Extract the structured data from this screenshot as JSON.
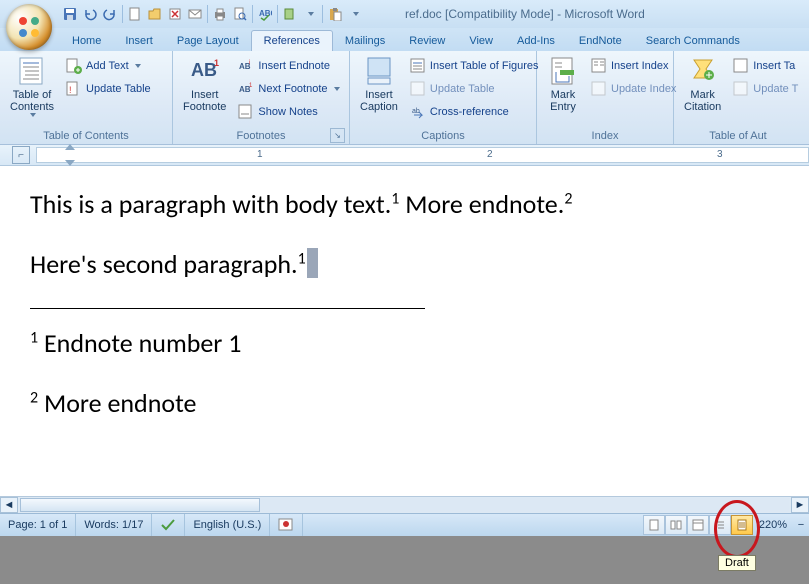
{
  "title": "ref.doc [Compatibility Mode] - Microsoft Word",
  "tabs": [
    "Home",
    "Insert",
    "Page Layout",
    "References",
    "Mailings",
    "Review",
    "View",
    "Add-Ins",
    "EndNote",
    "Search Commands"
  ],
  "active_tab": 3,
  "ribbon": {
    "toc": {
      "title": "Table of Contents",
      "main": "Table of\nContents",
      "add_text": "Add Text",
      "update": "Update Table"
    },
    "footnotes": {
      "title": "Footnotes",
      "main": "Insert\nFootnote",
      "endnote": "Insert Endnote",
      "next": "Next Footnote",
      "show": "Show Notes"
    },
    "captions": {
      "title": "Captions",
      "main": "Insert\nCaption",
      "figs": "Insert Table of Figures",
      "update": "Update Table",
      "xref": "Cross-reference"
    },
    "index": {
      "title": "Index",
      "main": "Mark\nEntry",
      "insert": "Insert Index",
      "update": "Update Index"
    },
    "toa": {
      "title": "Table of Aut",
      "main": "Mark\nCitation",
      "insert": "Insert Ta",
      "update": "Update T"
    }
  },
  "ruler_marks": [
    "1",
    "2",
    "3"
  ],
  "document": {
    "p1a": "This is a paragraph with body text.",
    "p1sup1": "1",
    "p1b": "  More endnote.",
    "p1sup2": "2",
    "p2": "Here's second paragraph.",
    "p2sup": "1",
    "en1sup": "1",
    "en1": " Endnote number 1",
    "en2sup": "2",
    "en2": " More endnote"
  },
  "status": {
    "page": "Page: 1 of 1",
    "words": "Words: 1/17",
    "lang": "English (U.S.)",
    "zoom": "220%"
  },
  "tooltip": "Draft"
}
